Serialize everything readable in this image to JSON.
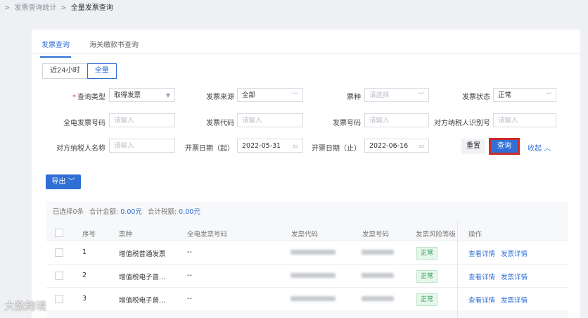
{
  "breadcrumb": {
    "sep": ">",
    "parent": "发票查询统计",
    "current": "全量发票查询"
  },
  "tabs": [
    "发票查询",
    "海关缴款书查询"
  ],
  "range": {
    "options": [
      "近24小时",
      "全量"
    ],
    "selected": "全量"
  },
  "form": {
    "row1": [
      {
        "label": "查询类型",
        "required": true,
        "value": "取得发票",
        "placeholder": "",
        "icon": "caret-down"
      },
      {
        "label": "发票来源",
        "required": false,
        "value": "全部",
        "placeholder": "",
        "icon": "chevron-down"
      },
      {
        "label": "票种",
        "required": false,
        "value": "",
        "placeholder": "请选择",
        "icon": "chevron-down"
      },
      {
        "label": "发票状态",
        "required": false,
        "value": "正常",
        "placeholder": "",
        "icon": "chevron-down"
      }
    ],
    "row2": [
      {
        "label": "全电发票号码",
        "placeholder": "请输入"
      },
      {
        "label": "发票代码",
        "placeholder": "请输入"
      },
      {
        "label": "发票号码",
        "placeholder": "请输入"
      },
      {
        "label": "对方纳税人识别号",
        "placeholder": "请输入"
      }
    ],
    "row3": [
      {
        "label": "对方纳税人名称",
        "placeholder": "请输入"
      },
      {
        "label": "开票日期（起）",
        "value": "2022-05-31"
      },
      {
        "label": "开票日期（止）",
        "value": "2022-06-16"
      }
    ]
  },
  "buttons": {
    "reset": "重置",
    "query": "查询",
    "collapse": "收起",
    "export": "导出"
  },
  "summary": {
    "selected": "已选择0条",
    "total_amount_label": "合计金额:",
    "total_amount": "0.00元",
    "total_tax_label": "合计税额:",
    "total_tax": "0.00元"
  },
  "table": {
    "headers": [
      "序号",
      "票种",
      "全电发票号码",
      "发票代码",
      "发票号码",
      "发票风险等级",
      "操作"
    ],
    "rows": [
      {
        "no": "1",
        "type": "增值税普通发票",
        "einvoice": "--",
        "risk": "正常",
        "actions": [
          "查看详情",
          "发票详情"
        ]
      },
      {
        "no": "2",
        "type": "增值税电子普...",
        "einvoice": "--",
        "risk": "正常",
        "actions": [
          "查看详情",
          "发票详情"
        ]
      },
      {
        "no": "3",
        "type": "增值税电子普...",
        "einvoice": "--",
        "risk": "正常",
        "actions": [
          "查看详情",
          "发票详情"
        ]
      }
    ]
  },
  "watermark": "大数跨境",
  "colors": {
    "primary": "#2f6fd6",
    "highlight_border": "#c92a2a",
    "ok_green": "#2e9b57"
  }
}
